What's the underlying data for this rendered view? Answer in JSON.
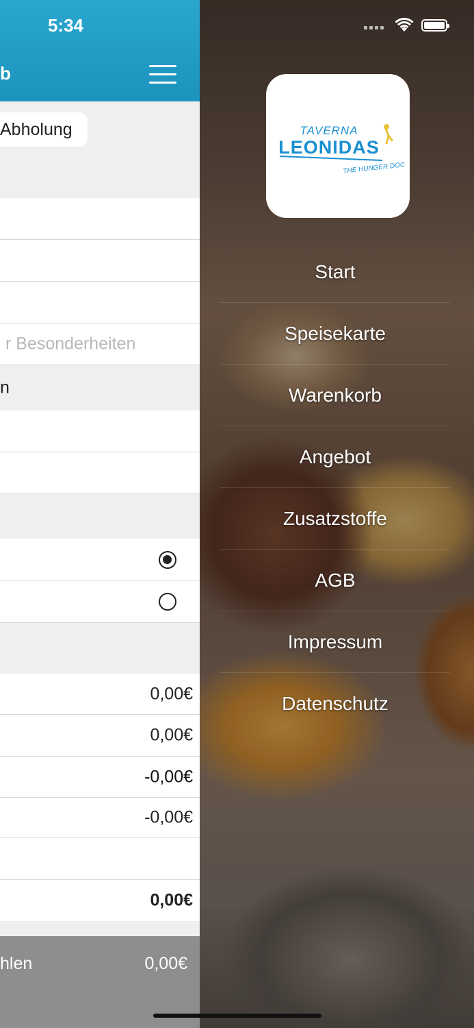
{
  "status_bar": {
    "time": "5:34"
  },
  "header": {
    "title": "b"
  },
  "order_type_chip": "Abholung",
  "form": {
    "notes_placeholder": "r Besonderheiten",
    "section_label": "n"
  },
  "summary": {
    "values": [
      "0,00€",
      "0,00€",
      "-0,00€",
      "-0,00€"
    ],
    "total": "0,00€"
  },
  "footer": {
    "label": "hlen",
    "amount": "0,00€"
  },
  "menu": {
    "items": [
      "Start",
      "Speisekarte",
      "Warenkorb",
      "Angebot",
      "Zusatzstoffe",
      "AGB",
      "Impressum",
      "Datenschutz"
    ]
  },
  "logo": {
    "line1": "TAVERNA",
    "line2": "LEONIDAS",
    "line3": "THE HUNGER DOC"
  },
  "colors": {
    "header": "#1b93bd",
    "logo_blue": "#1a8fd1"
  },
  "radio": {
    "selected_index": 0
  }
}
